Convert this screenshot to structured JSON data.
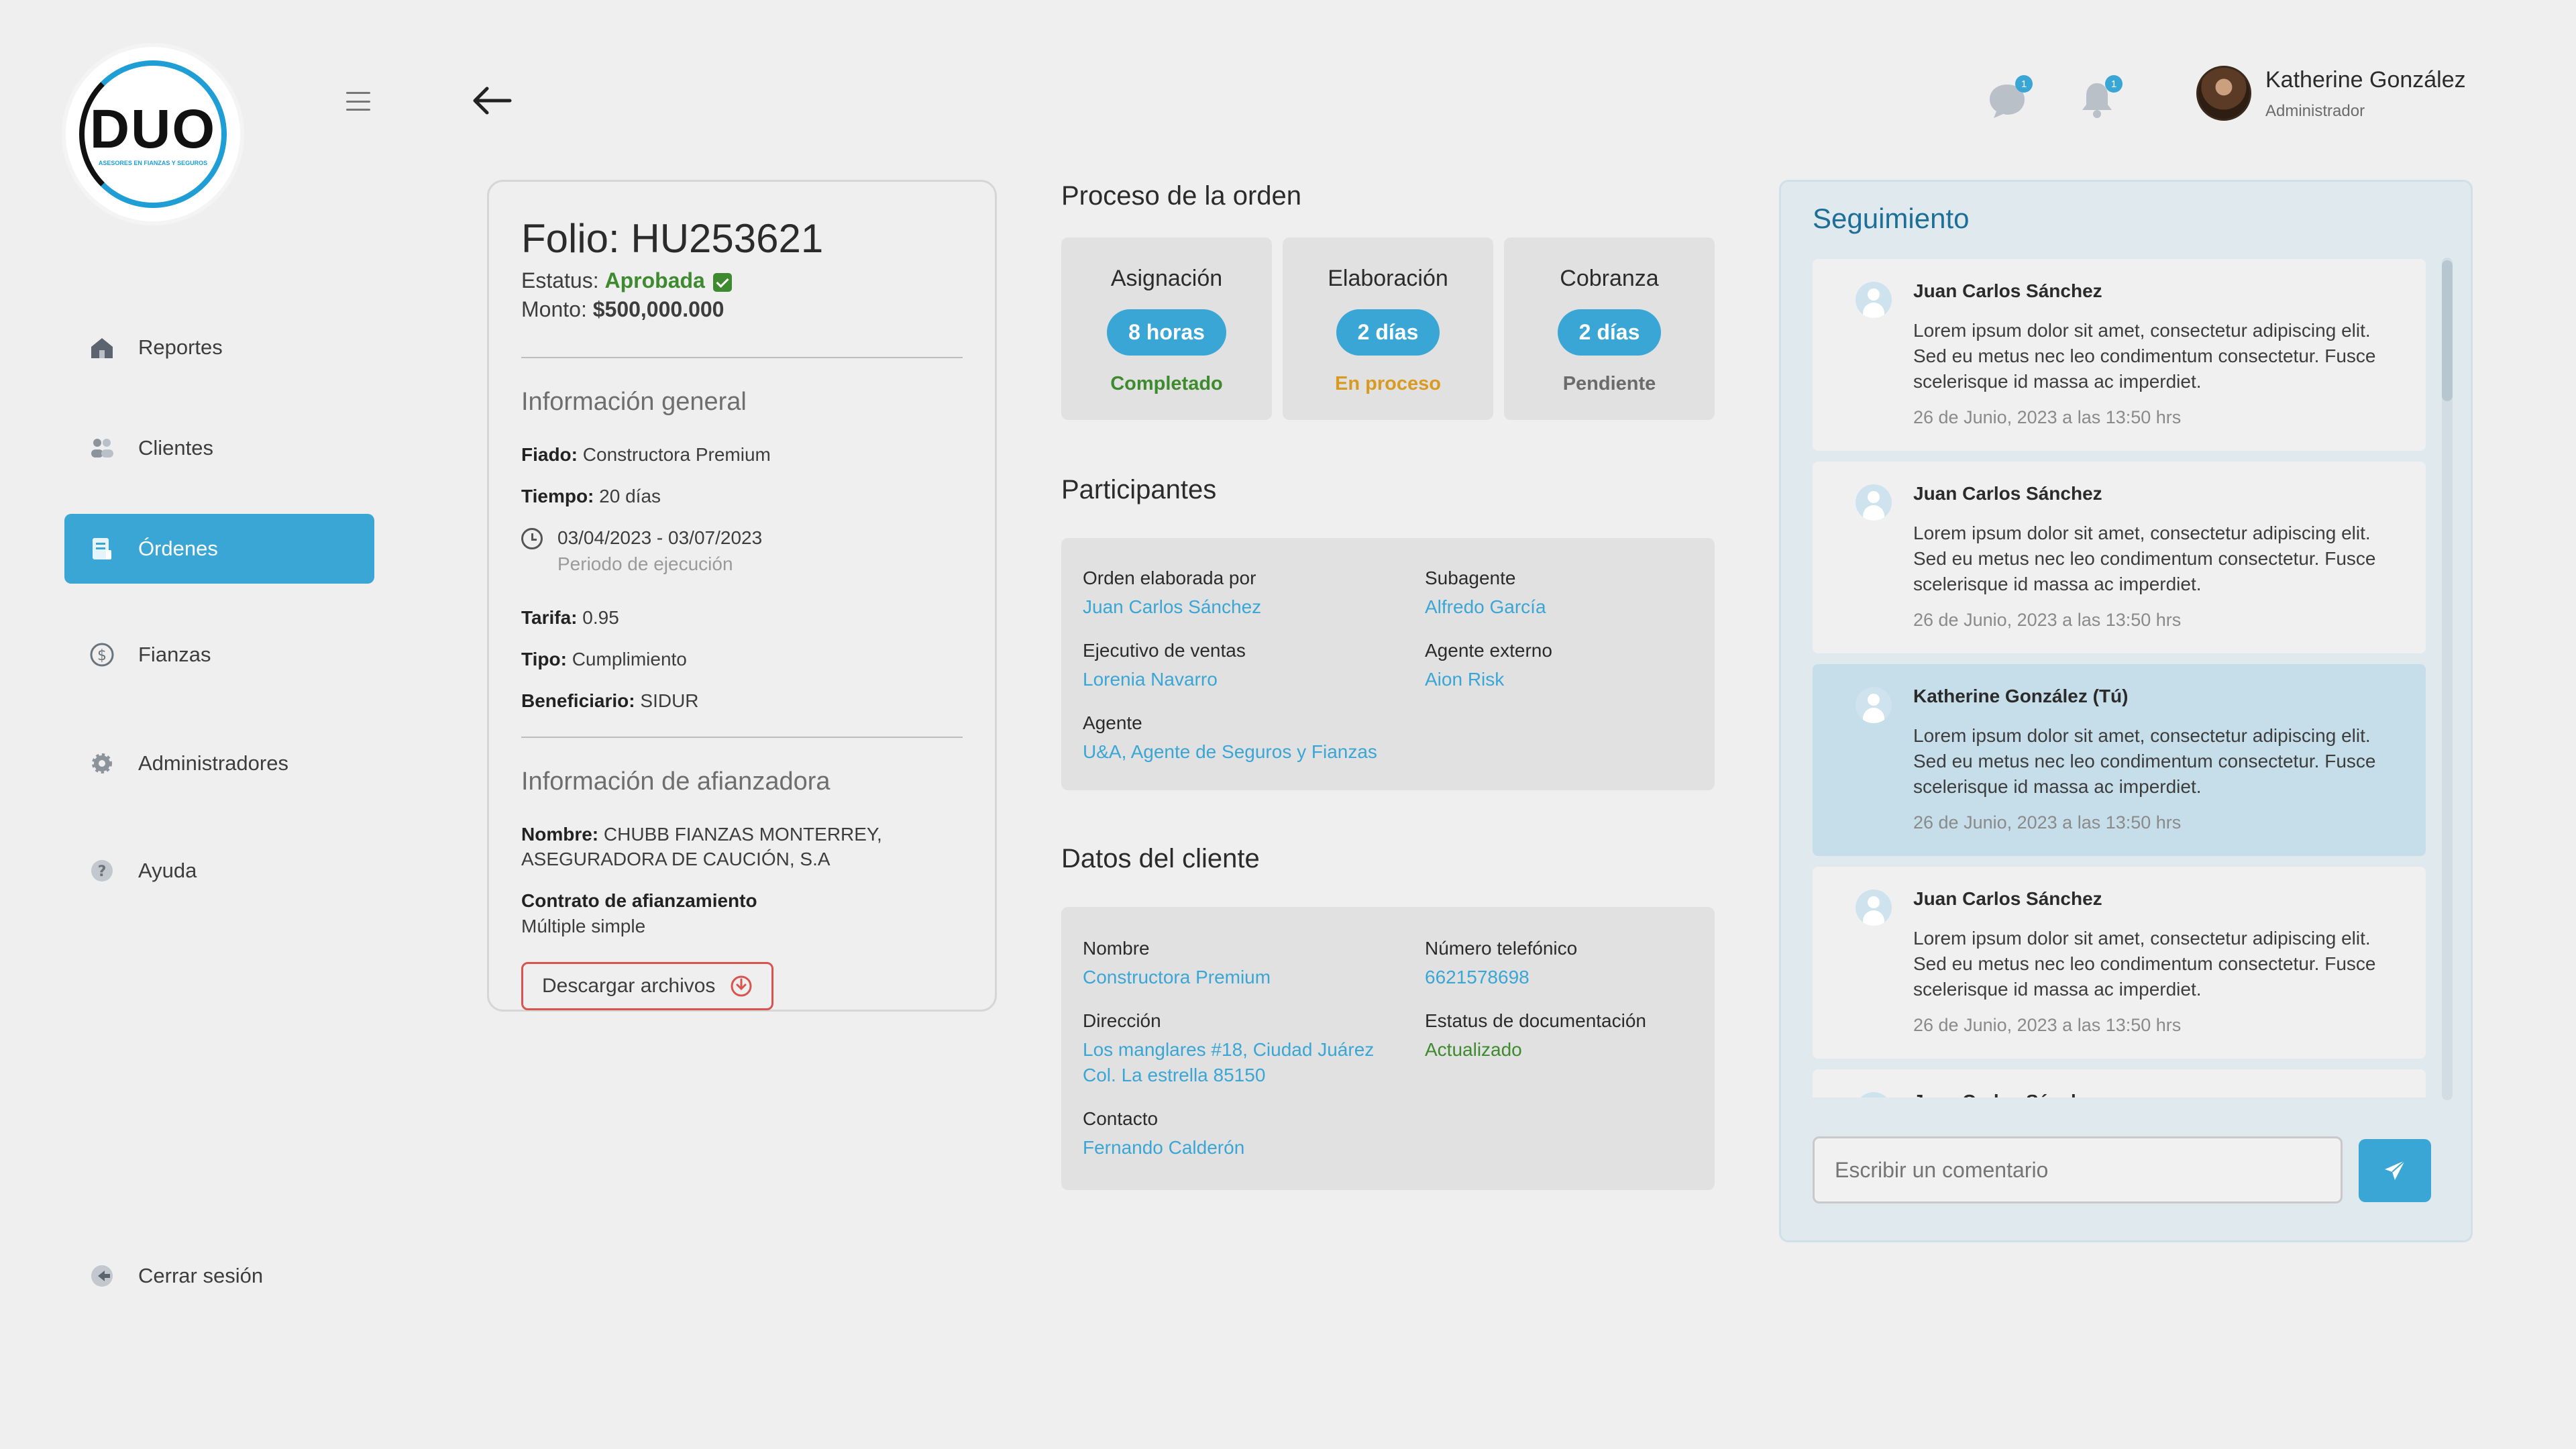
{
  "brand": {
    "logo_text": "DUO",
    "logo_subtext": "ASESORES EN FIANZAS Y SEGUROS"
  },
  "sidebar": {
    "items": [
      {
        "label": "Reportes",
        "icon": "home-icon",
        "active": false
      },
      {
        "label": "Clientes",
        "icon": "users-icon",
        "active": false
      },
      {
        "label": "Órdenes",
        "icon": "orders-icon",
        "active": true
      },
      {
        "label": "Fianzas",
        "icon": "dollar-icon",
        "active": false
      },
      {
        "label": "Administradores",
        "icon": "gear-icon",
        "active": false
      },
      {
        "label": "Ayuda",
        "icon": "help-icon",
        "active": false
      }
    ],
    "logout_label": "Cerrar sesión"
  },
  "header": {
    "messages_badge": "1",
    "notifications_badge": "1",
    "user_name": "Katherine González",
    "user_role": "Administrador"
  },
  "order": {
    "folio_label": "Folio:",
    "folio": "HU253621",
    "status_label": "Estatus:",
    "status": "Aprobada",
    "amount_label": "Monto:",
    "amount": "$500,000.000",
    "general": {
      "title": "Información general",
      "fiado_label": "Fiado:",
      "fiado": "Constructora Premium",
      "tiempo_label": "Tiempo:",
      "tiempo": "20 días",
      "period": "03/04/2023 - 03/07/2023",
      "period_label": "Periodo de ejecución",
      "tarifa_label": "Tarifa:",
      "tarifa": "0.95",
      "tipo_label": "Tipo:",
      "tipo": "Cumplimiento",
      "beneficiario_label": "Beneficiario:",
      "beneficiario": "SIDUR"
    },
    "afianzadora": {
      "title": "Información de afianzadora",
      "nombre_label": "Nombre:",
      "nombre": "CHUBB FIANZAS MONTERREY, ASEGURADORA DE CAUCIÓN, S.A",
      "contrato_label": "Contrato de afianzamiento",
      "contrato": "Múltiple simple"
    },
    "download_label": "Descargar archivos"
  },
  "process": {
    "title": "Proceso de la orden",
    "steps": [
      {
        "label": "Asignación",
        "duration": "8 horas",
        "state": "Completado",
        "state_color": "#3e8a2e"
      },
      {
        "label": "Elaboración",
        "duration": "2 días",
        "state": "En proceso",
        "state_color": "#d99a22"
      },
      {
        "label": "Cobranza",
        "duration": "2 días",
        "state": "Pendiente",
        "state_color": "#6b6b6b"
      }
    ]
  },
  "participants": {
    "title": "Participantes",
    "orden_label": "Orden elaborada por",
    "orden": "Juan Carlos Sánchez",
    "subagente_label": "Subagente",
    "subagente": "Alfredo García",
    "ejecutivo_label": "Ejecutivo de ventas",
    "ejecutivo": "Lorenia Navarro",
    "externo_label": "Agente externo",
    "externo": "Aion Risk",
    "agente_label": "Agente",
    "agente": "U&A, Agente de Seguros y Fianzas"
  },
  "client": {
    "title": "Datos del cliente",
    "nombre_label": "Nombre",
    "nombre": "Constructora Premium",
    "telefono_label": "Número telefónico",
    "telefono": "6621578698",
    "direccion_label": "Dirección",
    "direccion_1": "Los manglares #18, Ciudad Juárez",
    "direccion_2": "Col. La estrella 85150",
    "doc_label": "Estatus de documentación",
    "doc": "Actualizado",
    "contacto_label": "Contacto",
    "contacto": "Fernando Calderón"
  },
  "tracking": {
    "title": "Seguimiento",
    "comments": [
      {
        "author": "Juan Carlos Sánchez",
        "text": "Lorem ipsum dolor sit amet, consectetur adipiscing elit. Sed eu metus nec leo condimentum consectetur. Fusce scelerisque id massa ac imperdiet.",
        "date": "26 de Junio, 2023 a las 13:50 hrs",
        "mine": false
      },
      {
        "author": "Juan Carlos Sánchez",
        "text": "Lorem ipsum dolor sit amet, consectetur adipiscing elit. Sed eu metus nec leo condimentum consectetur. Fusce scelerisque id massa ac imperdiet.",
        "date": "26 de Junio, 2023 a las 13:50 hrs",
        "mine": false
      },
      {
        "author": "Katherine González (Tú)",
        "text": "Lorem ipsum dolor sit amet, consectetur adipiscing elit. Sed eu metus nec leo condimentum consectetur. Fusce scelerisque id massa ac imperdiet.",
        "date": "26 de Junio, 2023 a las 13:50 hrs",
        "mine": true
      },
      {
        "author": "Juan Carlos Sánchez",
        "text": "Lorem ipsum dolor sit amet, consectetur adipiscing elit. Sed eu metus nec leo condimentum consectetur. Fusce scelerisque id massa ac imperdiet.",
        "date": "26 de Junio, 2023 a las 13:50 hrs",
        "mine": false
      },
      {
        "author": "Juan Carlos Sánchez",
        "text": "",
        "date": "",
        "mine": false
      }
    ],
    "input_placeholder": "Escribir un comentario"
  }
}
